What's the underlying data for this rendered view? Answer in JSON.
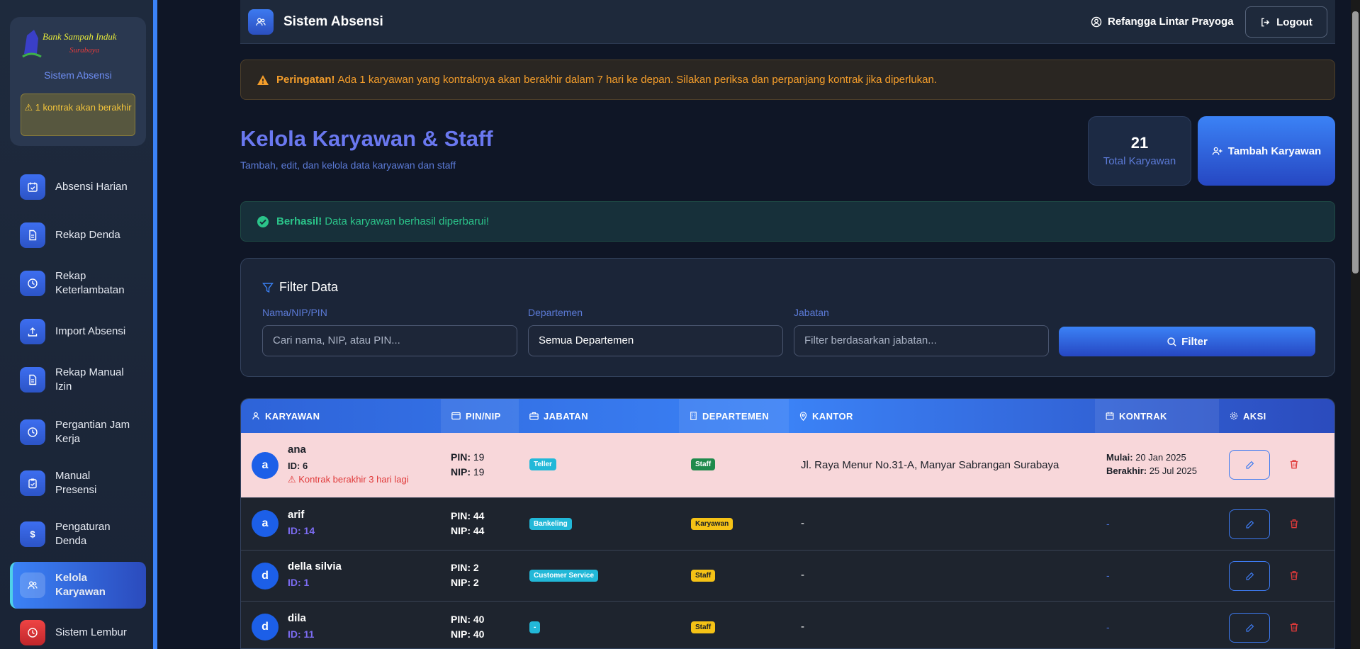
{
  "sidebar": {
    "logo_text_1": "Bank Sampah Induk",
    "logo_text_2": "Surabaya",
    "subtitle": "Sistem Absensi",
    "contract_warning": "⚠ 1 kontrak akan berakhir",
    "items": [
      {
        "label": "Absensi Harian",
        "icon": "calendar-check-icon"
      },
      {
        "label": "Rekap Denda",
        "icon": "document-icon"
      },
      {
        "label": "Rekap Keterlambatan",
        "icon": "clock-icon"
      },
      {
        "label": "Import Absensi",
        "icon": "upload-icon"
      },
      {
        "label": "Rekap Manual Izin",
        "icon": "document-icon"
      },
      {
        "label": "Pergantian Jam Kerja",
        "icon": "clock-icon"
      },
      {
        "label": "Manual Presensi",
        "icon": "clipboard-icon"
      },
      {
        "label": "Pengaturan Denda",
        "icon": "dollar-icon"
      },
      {
        "label": "Kelola Karyawan",
        "icon": "users-icon"
      },
      {
        "label": "Sistem Lembur",
        "icon": "clock-icon"
      }
    ]
  },
  "topbar": {
    "title": "Sistem Absensi",
    "user": "Refangga Lintar Prayoga",
    "logout": "Logout"
  },
  "warning": {
    "strong": "Peringatan!",
    "text": "Ada 1 karyawan yang kontraknya akan berakhir dalam 7 hari ke depan. Silakan periksa dan perpanjang kontrak jika diperlukan."
  },
  "page": {
    "title": "Kelola Karyawan & Staff",
    "subtitle": "Tambah, edit, dan kelola data karyawan dan staff",
    "total_count": "21",
    "total_label": "Total Karyawan",
    "add_button": "Tambah Karyawan"
  },
  "success": {
    "strong": "Berhasil!",
    "text": "Data karyawan berhasil diperbarui!"
  },
  "filter": {
    "title": "Filter Data",
    "name_label": "Nama/NIP/PIN",
    "name_placeholder": "Cari nama, NIP, atau PIN...",
    "dept_label": "Departemen",
    "dept_value": "Semua Departemen",
    "jabatan_label": "Jabatan",
    "jabatan_placeholder": "Filter berdasarkan jabatan...",
    "button": "Filter"
  },
  "table": {
    "headers": [
      "KARYAWAN",
      "PIN/NIP",
      "JABATAN",
      "DEPARTEMEN",
      "KANTOR",
      "KONTRAK",
      "AKSI"
    ],
    "rows": [
      {
        "initial": "a",
        "name": "ana",
        "id": "ID: 6",
        "warn": "⚠ Kontrak berakhir 3 hari lagi",
        "pin": "19",
        "nip": "19",
        "jabatan": "Teller",
        "departemen": "Staff",
        "kantor": "Jl. Raya Menur No.31-A, Manyar Sabrangan Surabaya",
        "mulai_label": "Mulai:",
        "mulai": "20 Jan 2025",
        "berakhir_label": "Berakhir:",
        "berakhir": "25 Jul 2025"
      },
      {
        "initial": "a",
        "name": "arif",
        "id": "ID: 14",
        "pin": "44",
        "nip": "44",
        "jabatan": "Bankeling",
        "departemen": "Karyawan",
        "kantor": "-",
        "kontrak": "-"
      },
      {
        "initial": "d",
        "name": "della silvia",
        "id": "ID: 1",
        "pin": "2",
        "nip": "2",
        "jabatan": "Customer Service",
        "departemen": "Staff",
        "kantor": "-",
        "kontrak": "-"
      },
      {
        "initial": "d",
        "name": "dila",
        "id": "ID: 11",
        "pin": "40",
        "nip": "40",
        "jabatan": "-",
        "departemen": "Staff",
        "kantor": "-",
        "kontrak": "-"
      }
    ],
    "pin_label": "PIN:",
    "nip_label": "NIP:"
  },
  "colors": {
    "accent": "#3b82f6",
    "warning": "#f59e2b",
    "success": "#2bc48a",
    "danger": "#e03a3a"
  }
}
